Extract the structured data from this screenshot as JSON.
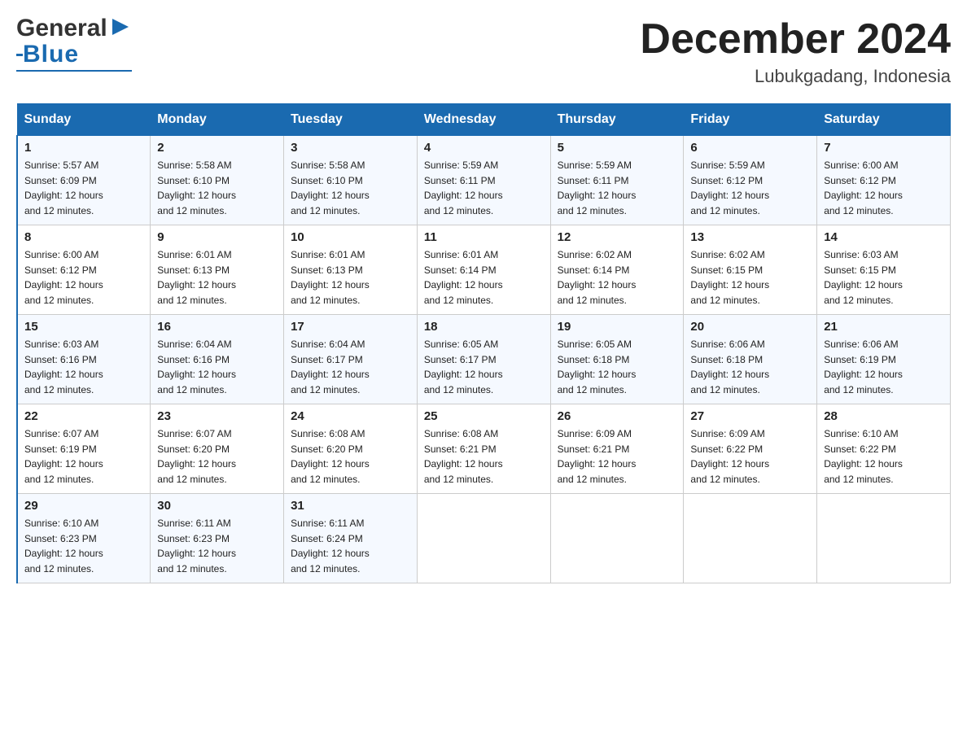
{
  "header": {
    "logo_main": "General",
    "logo_blue": "Blue",
    "month_title": "December 2024",
    "location": "Lubukgadang, Indonesia"
  },
  "days_of_week": [
    "Sunday",
    "Monday",
    "Tuesday",
    "Wednesday",
    "Thursday",
    "Friday",
    "Saturday"
  ],
  "weeks": [
    [
      {
        "day": "1",
        "sunrise": "5:57 AM",
        "sunset": "6:09 PM",
        "daylight": "12 hours and 12 minutes."
      },
      {
        "day": "2",
        "sunrise": "5:58 AM",
        "sunset": "6:10 PM",
        "daylight": "12 hours and 12 minutes."
      },
      {
        "day": "3",
        "sunrise": "5:58 AM",
        "sunset": "6:10 PM",
        "daylight": "12 hours and 12 minutes."
      },
      {
        "day": "4",
        "sunrise": "5:59 AM",
        "sunset": "6:11 PM",
        "daylight": "12 hours and 12 minutes."
      },
      {
        "day": "5",
        "sunrise": "5:59 AM",
        "sunset": "6:11 PM",
        "daylight": "12 hours and 12 minutes."
      },
      {
        "day": "6",
        "sunrise": "5:59 AM",
        "sunset": "6:12 PM",
        "daylight": "12 hours and 12 minutes."
      },
      {
        "day": "7",
        "sunrise": "6:00 AM",
        "sunset": "6:12 PM",
        "daylight": "12 hours and 12 minutes."
      }
    ],
    [
      {
        "day": "8",
        "sunrise": "6:00 AM",
        "sunset": "6:12 PM",
        "daylight": "12 hours and 12 minutes."
      },
      {
        "day": "9",
        "sunrise": "6:01 AM",
        "sunset": "6:13 PM",
        "daylight": "12 hours and 12 minutes."
      },
      {
        "day": "10",
        "sunrise": "6:01 AM",
        "sunset": "6:13 PM",
        "daylight": "12 hours and 12 minutes."
      },
      {
        "day": "11",
        "sunrise": "6:01 AM",
        "sunset": "6:14 PM",
        "daylight": "12 hours and 12 minutes."
      },
      {
        "day": "12",
        "sunrise": "6:02 AM",
        "sunset": "6:14 PM",
        "daylight": "12 hours and 12 minutes."
      },
      {
        "day": "13",
        "sunrise": "6:02 AM",
        "sunset": "6:15 PM",
        "daylight": "12 hours and 12 minutes."
      },
      {
        "day": "14",
        "sunrise": "6:03 AM",
        "sunset": "6:15 PM",
        "daylight": "12 hours and 12 minutes."
      }
    ],
    [
      {
        "day": "15",
        "sunrise": "6:03 AM",
        "sunset": "6:16 PM",
        "daylight": "12 hours and 12 minutes."
      },
      {
        "day": "16",
        "sunrise": "6:04 AM",
        "sunset": "6:16 PM",
        "daylight": "12 hours and 12 minutes."
      },
      {
        "day": "17",
        "sunrise": "6:04 AM",
        "sunset": "6:17 PM",
        "daylight": "12 hours and 12 minutes."
      },
      {
        "day": "18",
        "sunrise": "6:05 AM",
        "sunset": "6:17 PM",
        "daylight": "12 hours and 12 minutes."
      },
      {
        "day": "19",
        "sunrise": "6:05 AM",
        "sunset": "6:18 PM",
        "daylight": "12 hours and 12 minutes."
      },
      {
        "day": "20",
        "sunrise": "6:06 AM",
        "sunset": "6:18 PM",
        "daylight": "12 hours and 12 minutes."
      },
      {
        "day": "21",
        "sunrise": "6:06 AM",
        "sunset": "6:19 PM",
        "daylight": "12 hours and 12 minutes."
      }
    ],
    [
      {
        "day": "22",
        "sunrise": "6:07 AM",
        "sunset": "6:19 PM",
        "daylight": "12 hours and 12 minutes."
      },
      {
        "day": "23",
        "sunrise": "6:07 AM",
        "sunset": "6:20 PM",
        "daylight": "12 hours and 12 minutes."
      },
      {
        "day": "24",
        "sunrise": "6:08 AM",
        "sunset": "6:20 PM",
        "daylight": "12 hours and 12 minutes."
      },
      {
        "day": "25",
        "sunrise": "6:08 AM",
        "sunset": "6:21 PM",
        "daylight": "12 hours and 12 minutes."
      },
      {
        "day": "26",
        "sunrise": "6:09 AM",
        "sunset": "6:21 PM",
        "daylight": "12 hours and 12 minutes."
      },
      {
        "day": "27",
        "sunrise": "6:09 AM",
        "sunset": "6:22 PM",
        "daylight": "12 hours and 12 minutes."
      },
      {
        "day": "28",
        "sunrise": "6:10 AM",
        "sunset": "6:22 PM",
        "daylight": "12 hours and 12 minutes."
      }
    ],
    [
      {
        "day": "29",
        "sunrise": "6:10 AM",
        "sunset": "6:23 PM",
        "daylight": "12 hours and 12 minutes."
      },
      {
        "day": "30",
        "sunrise": "6:11 AM",
        "sunset": "6:23 PM",
        "daylight": "12 hours and 12 minutes."
      },
      {
        "day": "31",
        "sunrise": "6:11 AM",
        "sunset": "6:24 PM",
        "daylight": "12 hours and 12 minutes."
      },
      null,
      null,
      null,
      null
    ]
  ],
  "labels": {
    "sunrise": "Sunrise:",
    "sunset": "Sunset:",
    "daylight": "Daylight:"
  }
}
